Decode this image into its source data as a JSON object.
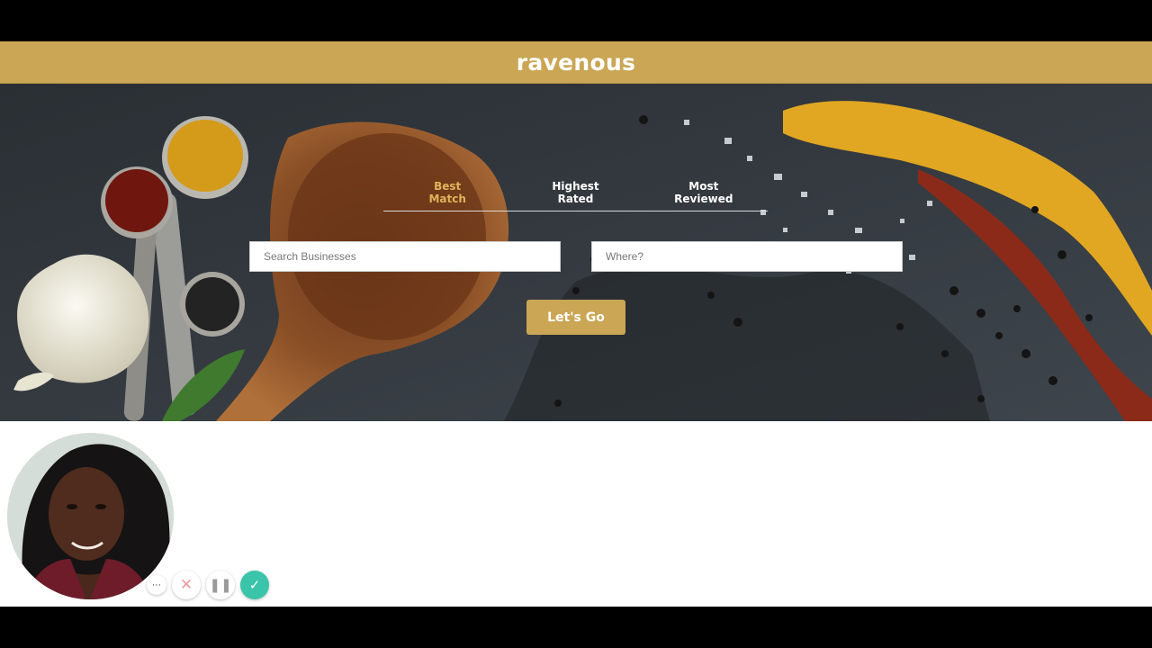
{
  "app": {
    "logo": "ravenous"
  },
  "sort_options": [
    {
      "line1": "Best",
      "line2": "Match",
      "active": true
    },
    {
      "line1": "Highest",
      "line2": "Rated",
      "active": false
    },
    {
      "line1": "Most",
      "line2": "Reviewed",
      "active": false
    }
  ],
  "search": {
    "business_placeholder": "Search Businesses",
    "location_placeholder": "Where?",
    "submit_label": "Let's Go"
  },
  "recorder": {
    "more_icon": "more-icon",
    "cancel_icon": "close-icon",
    "pause_icon": "pause-icon",
    "done_icon": "check-icon"
  },
  "colors": {
    "brand": "#caa655",
    "active_sort": "#e0b35a",
    "confirm": "#3ac4a9"
  }
}
